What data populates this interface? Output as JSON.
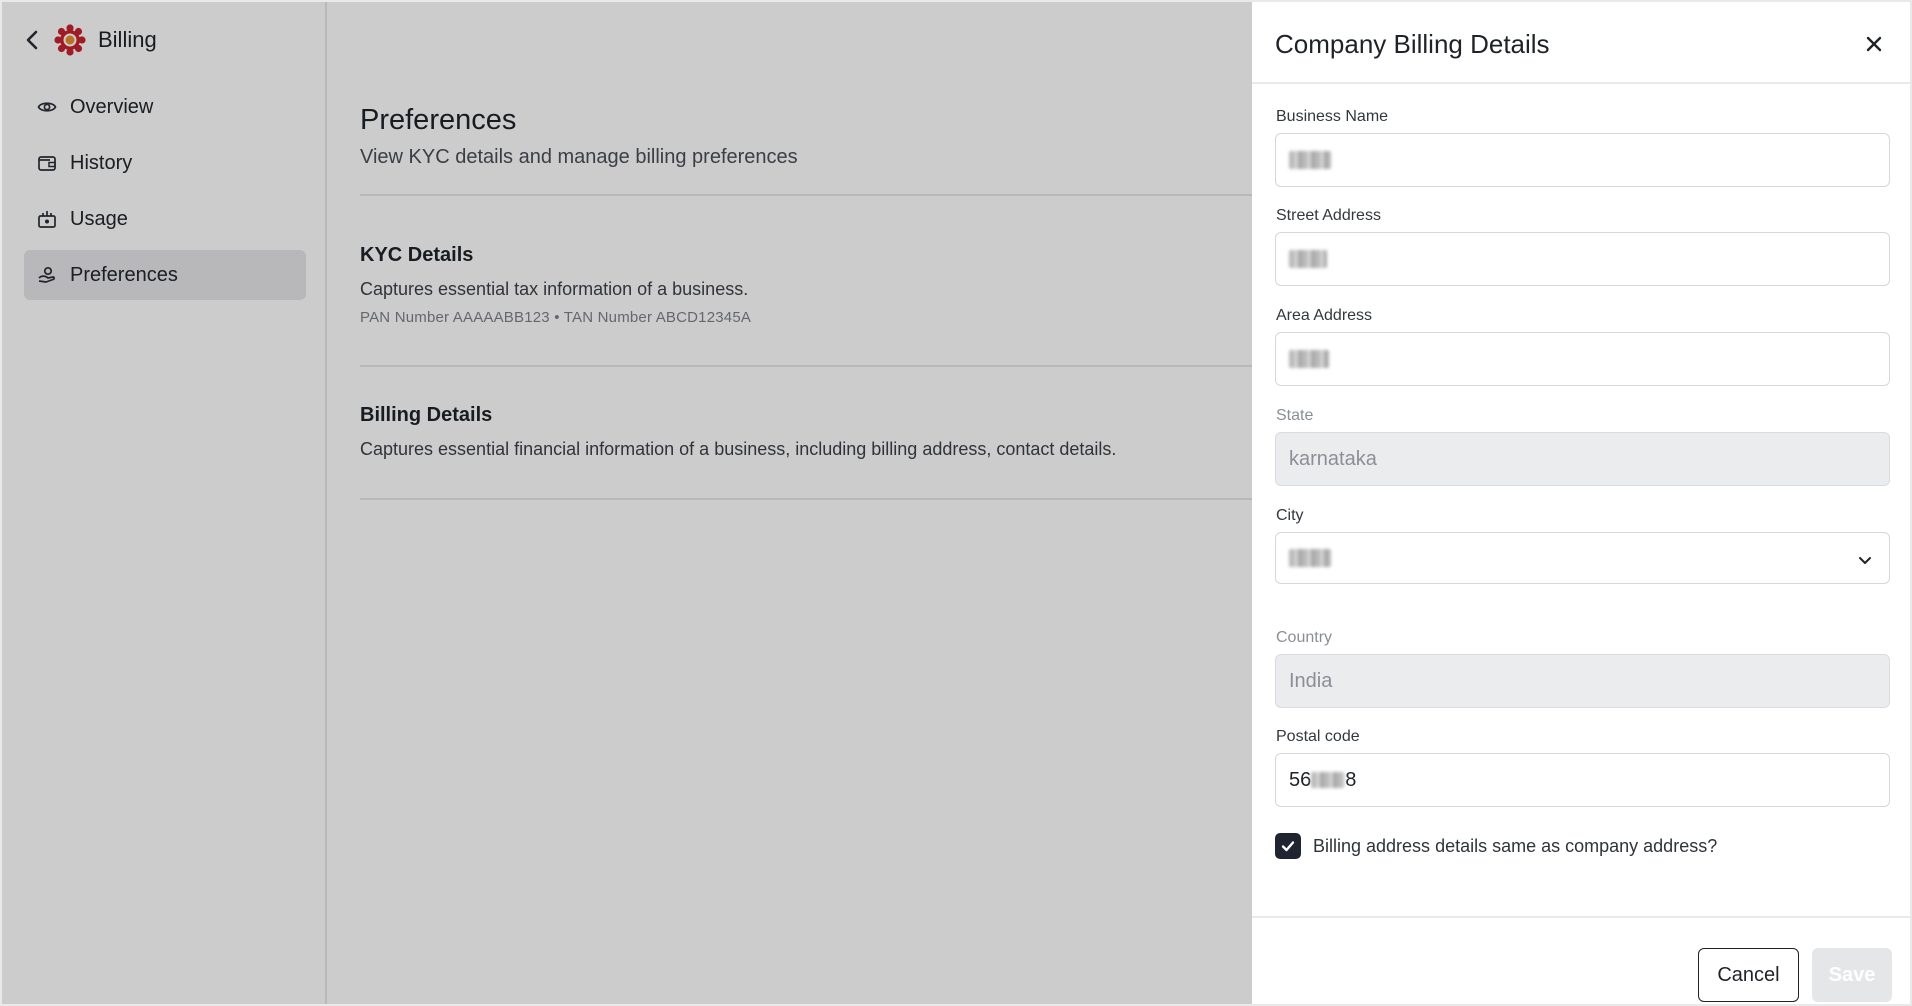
{
  "sidebar": {
    "title": "Billing",
    "items": [
      {
        "label": "Overview",
        "icon": "eye-icon"
      },
      {
        "label": "History",
        "icon": "wallet-icon"
      },
      {
        "label": "Usage",
        "icon": "usage-icon"
      },
      {
        "label": "Preferences",
        "icon": "preferences-icon",
        "active": true
      }
    ]
  },
  "main": {
    "title": "Preferences",
    "subtitle": "View KYC details and manage billing preferences",
    "sections": [
      {
        "title": "KYC Details",
        "description": "Captures essential tax information of a business.",
        "meta": "PAN Number AAAAABB123 • TAN Number ABCD12345A"
      },
      {
        "title": "Billing Details",
        "description": "Captures essential financial information of a business, including billing address, contact details."
      }
    ]
  },
  "drawer": {
    "title": "Company Billing Details",
    "fields": {
      "business_name": {
        "label": "Business Name"
      },
      "street_address": {
        "label": "Street Address"
      },
      "area_address": {
        "label": "Area Address"
      },
      "state": {
        "label": "State",
        "value": "karnataka"
      },
      "city": {
        "label": "City"
      },
      "country": {
        "label": "Country",
        "value": "India"
      },
      "postal_code": {
        "label": "Postal code",
        "value_start": "56",
        "value_end": "8"
      }
    },
    "checkbox_label": "Billing address details same as company address?",
    "checkbox_checked": true,
    "cancel_label": "Cancel",
    "save_label": "Save"
  },
  "colors": {
    "overlay": "#000000",
    "checkbox": "#1e2530",
    "logo_red": "#c8242f",
    "logo_orange": "#e8902b"
  }
}
